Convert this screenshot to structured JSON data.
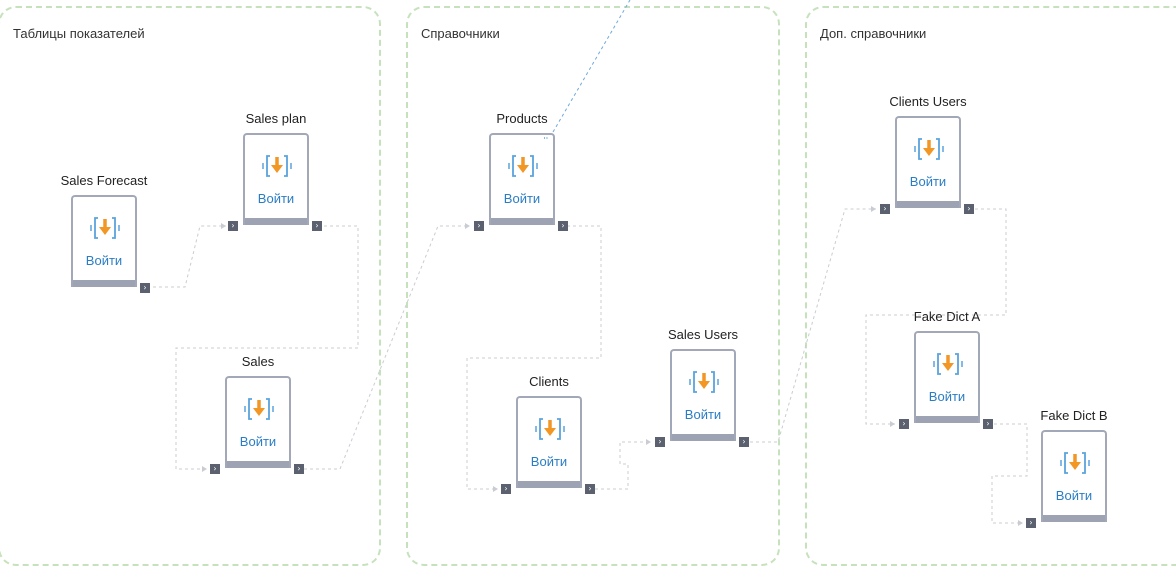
{
  "groups": [
    {
      "title": "Таблицы показателей"
    },
    {
      "title": "Справочники"
    },
    {
      "title": "Доп. справочники"
    }
  ],
  "enter_label": "Войти",
  "port_glyph": "›",
  "colors": {
    "group_border": "#c6e2bd",
    "node_border": "#a3a8b8",
    "node_bar": "#9ea3b3",
    "port": "#5c6170",
    "link_text": "#2a7dc4",
    "icon_bracket": "#5aa3dc",
    "icon_arrow": "#f29624",
    "wire": "#c9ccd2",
    "wire_blue": "#6fa9dc"
  },
  "nodes": [
    {
      "id": "sales-forecast",
      "title": "Sales Forecast"
    },
    {
      "id": "sales-plan",
      "title": "Sales plan"
    },
    {
      "id": "sales",
      "title": "Sales"
    },
    {
      "id": "products",
      "title": "Products",
      "badge": "ʿʿ"
    },
    {
      "id": "clients",
      "title": "Clients"
    },
    {
      "id": "sales-users",
      "title": "Sales Users"
    },
    {
      "id": "clients-users",
      "title": "Clients Users"
    },
    {
      "id": "fake-dict-a",
      "title": "Fake Dict A"
    },
    {
      "id": "fake-dict-b",
      "title": "Fake Dict B"
    }
  ],
  "links": [
    {
      "from": "sales-forecast",
      "to": "sales-plan"
    },
    {
      "from": "sales-plan",
      "to": "sales"
    },
    {
      "from": "sales",
      "to": "products"
    },
    {
      "from": "products",
      "to": "clients"
    },
    {
      "from": "clients",
      "to": "sales-users"
    },
    {
      "from": "sales-users",
      "to": "clients-users"
    },
    {
      "from": "clients-users",
      "to": "fake-dict-a"
    },
    {
      "from": "fake-dict-a",
      "to": "fake-dict-b"
    }
  ]
}
